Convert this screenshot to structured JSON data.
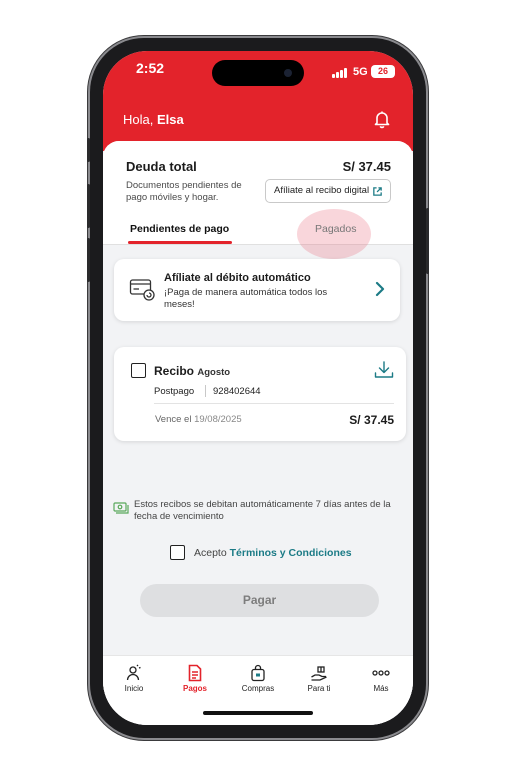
{
  "status_bar": {
    "time": "2:52",
    "network": "5G",
    "battery": "26"
  },
  "header": {
    "greeting_prefix": "Hola,",
    "user_name": "Elsa"
  },
  "summary": {
    "title": "Deuda total",
    "amount": "S/ 37.45",
    "description": "Documentos pendientes de pago móviles y hogar.",
    "affiliate_button": "Afíliate al recibo digital"
  },
  "tabs": {
    "pending": "Pendientes de pago",
    "paid": "Pagados"
  },
  "autodebit": {
    "title": "Afíliate al débito automático",
    "subtitle": "¡Paga de manera automática todos los meses!"
  },
  "receipt": {
    "title": "Recibo",
    "month": "Agosto",
    "plan": "Postpago",
    "number": "928402644",
    "due_label": "Vence el",
    "due_date": "19/08/2025",
    "amount": "S/ 37.45"
  },
  "note": "Estos recibos se debitan automáticamente 7 días antes de la fecha de vencimiento",
  "terms": {
    "prefix": "Acepto",
    "link": "Términos y Condiciones"
  },
  "pay_button": "Pagar",
  "nav": {
    "items": [
      {
        "label": "Inicio",
        "icon": "home-person-icon"
      },
      {
        "label": "Pagos",
        "icon": "receipt-icon",
        "active": true
      },
      {
        "label": "Compras",
        "icon": "shopping-bag-icon"
      },
      {
        "label": "Para ti",
        "icon": "gift-hand-icon"
      },
      {
        "label": "Más",
        "icon": "more-dots-icon"
      }
    ]
  },
  "colors": {
    "brand_red": "#e3232b",
    "link_teal": "#1c7b86",
    "background": "#f2f3f5"
  }
}
